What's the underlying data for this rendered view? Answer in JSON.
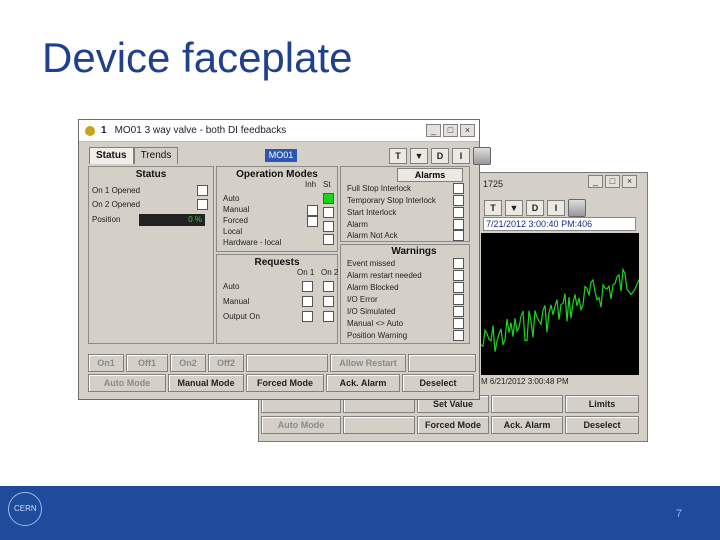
{
  "slide": {
    "title": "Device faceplate",
    "page_number": "7"
  },
  "back_window": {
    "value_text": "1725",
    "toolbar": [
      "T",
      "▼",
      "D",
      "I"
    ],
    "date_text": "7/21/2012 3:00:40 PM:406",
    "trend_color": "#1cd41c",
    "x_label": "M  6/21/2012 3:00:48 PM",
    "row1": [
      "",
      "",
      "Set Value",
      "",
      "Limits"
    ],
    "row2": [
      "Auto Mode",
      "",
      "Forced Mode",
      "Ack. Alarm",
      "Deselect"
    ]
  },
  "front_window": {
    "title": "MO01 3 way valve - both DI feedbacks",
    "title_num": "1",
    "tabs": [
      "Status",
      "Trends"
    ],
    "device_name": "MO01",
    "toolbar": [
      "T",
      "▼",
      "D",
      "I"
    ],
    "status": {
      "title": "Status",
      "rows": [
        "On 1 Opened",
        "On 2 Opened",
        "Position"
      ],
      "position_value": "0 %"
    },
    "operation_modes": {
      "title": "Operation Modes",
      "col_inh": "Inh",
      "col_st": "St",
      "rows": [
        "Auto",
        "Manual",
        "Forced",
        "Local",
        "Hardware - local"
      ]
    },
    "requests": {
      "title": "Requests",
      "col1": "On 1",
      "col2": "On 2",
      "rows": [
        "Auto",
        "Manual",
        "Output On"
      ]
    },
    "alarms": {
      "title": "Alarms",
      "rows": [
        "Full Stop Interlock",
        "Temporary Stop Interlock",
        "Start Interlock",
        "Alarm",
        "Alarm Not Ack"
      ]
    },
    "warnings": {
      "title": "Warnings",
      "rows": [
        "Event missed",
        "Alarm restart needed",
        "Alarm Blocked",
        "I/O Error",
        "I/O Simulated",
        "Manual <> Auto",
        "Position Warning"
      ]
    },
    "buttons_row1": [
      "On1",
      "Off1",
      "On2",
      "Off2",
      "",
      "Allow Restart",
      ""
    ],
    "buttons_row2": [
      "Auto Mode",
      "Manual Mode",
      "Forced Mode",
      "Ack. Alarm",
      "Deselect"
    ]
  }
}
